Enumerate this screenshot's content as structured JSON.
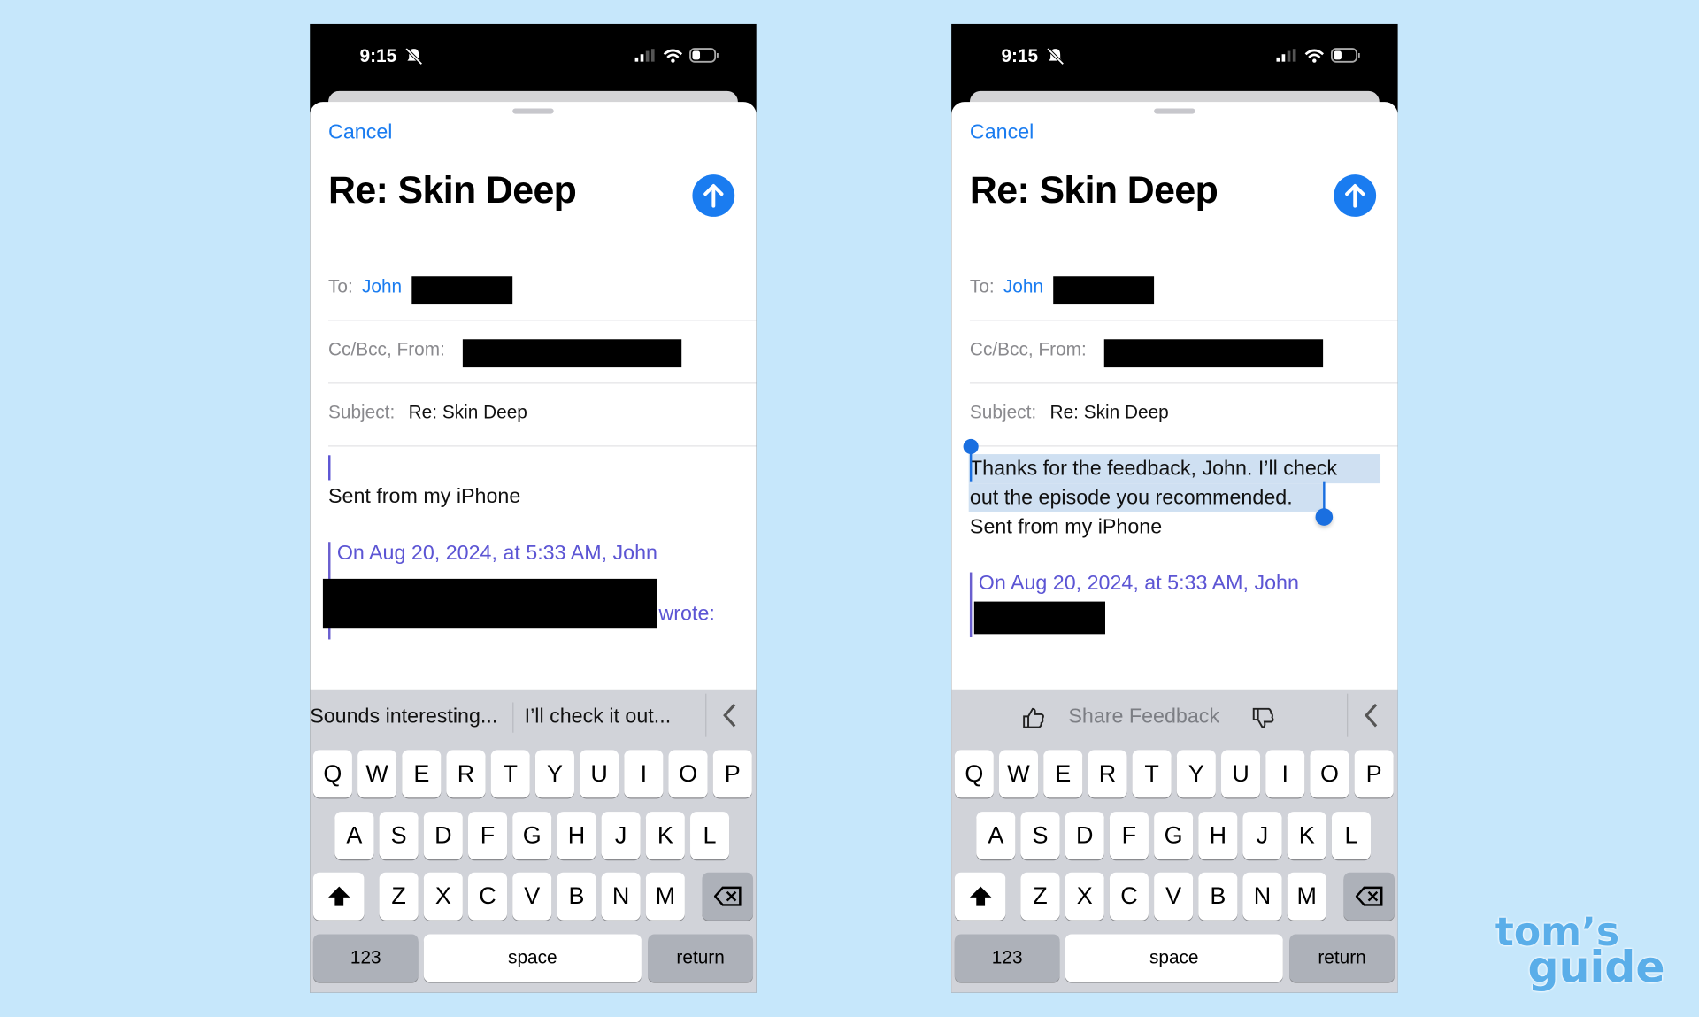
{
  "screens": [
    {
      "status": {
        "time": "9:15"
      },
      "compose": {
        "cancel_label": "Cancel",
        "title": "Re: Skin Deep",
        "to_label": "To:",
        "to_name": "John",
        "ccbcc_label": "Cc/Bcc, From:",
        "subject_label": "Subject:",
        "subject_value": "Re: Skin Deep",
        "body_lines": [
          "",
          "Sent from my iPhone"
        ],
        "quote_header": "On Aug 20, 2024, at 5:33 AM, John",
        "quote_wrote": "wrote:"
      },
      "suggestions": [
        "Sounds interesting...",
        "I’ll check it out..."
      ],
      "keyboard": {}
    },
    {
      "status": {
        "time": "9:15"
      },
      "compose": {
        "cancel_label": "Cancel",
        "title": "Re: Skin Deep",
        "to_label": "To:",
        "to_name": "John",
        "ccbcc_label": "Cc/Bcc, From:",
        "subject_label": "Subject:",
        "subject_value": "Re: Skin Deep",
        "body_lines": [
          "Thanks for the feedback, John. I’ll check",
          "out the episode you recommended.",
          "Sent from my iPhone"
        ],
        "quote_header": "On Aug 20, 2024, at 5:33 AM, John"
      },
      "feedback_label": "Share Feedback",
      "keyboard": {}
    }
  ],
  "keyboard": {
    "row1": [
      "Q",
      "W",
      "E",
      "R",
      "T",
      "Y",
      "U",
      "I",
      "O",
      "P"
    ],
    "row2": [
      "A",
      "S",
      "D",
      "F",
      "G",
      "H",
      "J",
      "K",
      "L"
    ],
    "row3": [
      "Z",
      "X",
      "C",
      "V",
      "B",
      "N",
      "M"
    ],
    "numbers_label": "123",
    "space_label": "space",
    "return_label": "return"
  },
  "colors": {
    "accent": "#1a7cf0",
    "quote": "#5c55d4",
    "selection": "#cfe0f2",
    "background": "#c6e7fb"
  },
  "logo": {
    "line1": "tom’s",
    "line2": "guide"
  }
}
